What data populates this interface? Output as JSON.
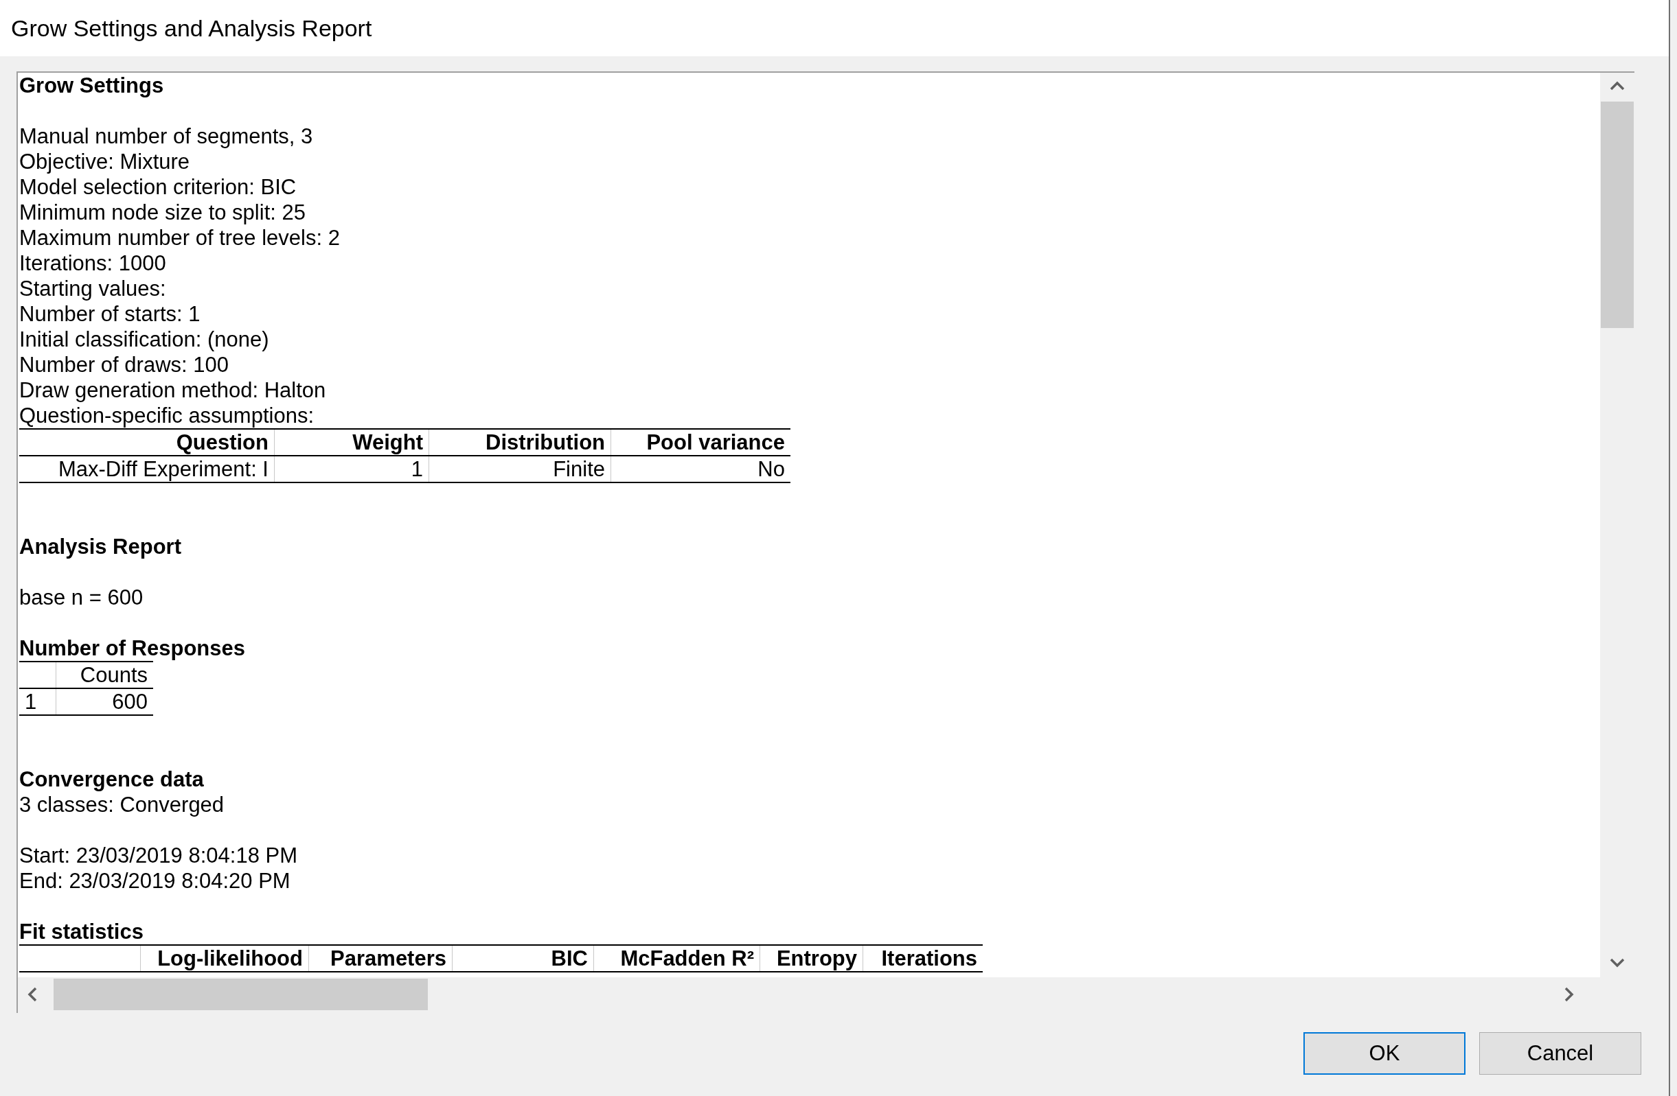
{
  "window": {
    "title": "Grow Settings and Analysis Report"
  },
  "report": [
    {
      "kind": "heading",
      "text": "Grow Settings"
    },
    {
      "kind": "blank"
    },
    {
      "kind": "line",
      "text": "Manual number of segments, 3"
    },
    {
      "kind": "line",
      "text": "Objective: Mixture"
    },
    {
      "kind": "line",
      "text": "Model selection criterion: BIC"
    },
    {
      "kind": "line",
      "text": "Minimum node size to split: 25"
    },
    {
      "kind": "line",
      "text": "Maximum number of tree levels: 2"
    },
    {
      "kind": "line",
      "text": "Iterations: 1000"
    },
    {
      "kind": "line",
      "text": "Starting values:"
    },
    {
      "kind": "line",
      "text": "Number of starts: 1"
    },
    {
      "kind": "line",
      "text": "Initial classification: (none)"
    },
    {
      "kind": "line",
      "text": "Number of draws: 100"
    },
    {
      "kind": "line",
      "text": "Draw generation method: Halton"
    },
    {
      "kind": "line",
      "text": "Question-specific assumptions:"
    },
    {
      "kind": "table",
      "row_labels": false,
      "columns": [
        "Question",
        "Weight",
        "Distribution",
        "Pool variance"
      ],
      "rows": [
        [
          "Max-Diff Experiment: I",
          "1",
          "Finite",
          "No"
        ]
      ]
    },
    {
      "kind": "blank"
    },
    {
      "kind": "blank"
    },
    {
      "kind": "heading",
      "text": "Analysis Report"
    },
    {
      "kind": "blank"
    },
    {
      "kind": "line",
      "text": "base n = 600"
    },
    {
      "kind": "blank"
    },
    {
      "kind": "heading",
      "text": "Number of Responses"
    },
    {
      "kind": "table",
      "row_labels": true,
      "columns": [
        "",
        "Counts"
      ],
      "rows": [
        [
          "1",
          "600"
        ]
      ]
    },
    {
      "kind": "blank"
    },
    {
      "kind": "blank"
    },
    {
      "kind": "heading",
      "text": "Convergence data"
    },
    {
      "kind": "line",
      "text": "3 classes: Converged"
    },
    {
      "kind": "blank"
    },
    {
      "kind": "line",
      "text": "Start: 23/03/2019 8:04:18 PM"
    },
    {
      "kind": "line",
      "text": "End: 23/03/2019 8:04:20 PM"
    },
    {
      "kind": "blank"
    },
    {
      "kind": "heading",
      "text": "Fit statistics"
    },
    {
      "kind": "table",
      "row_labels": false,
      "columns": [
        "",
        "Log-likelihood",
        "Parameters",
        "BIC",
        "McFadden R²",
        "Entropy",
        "Iterations"
      ]
    }
  ],
  "buttons": [
    {
      "label": "OK",
      "focused": true
    },
    {
      "label": "Cancel",
      "focused": false
    }
  ]
}
